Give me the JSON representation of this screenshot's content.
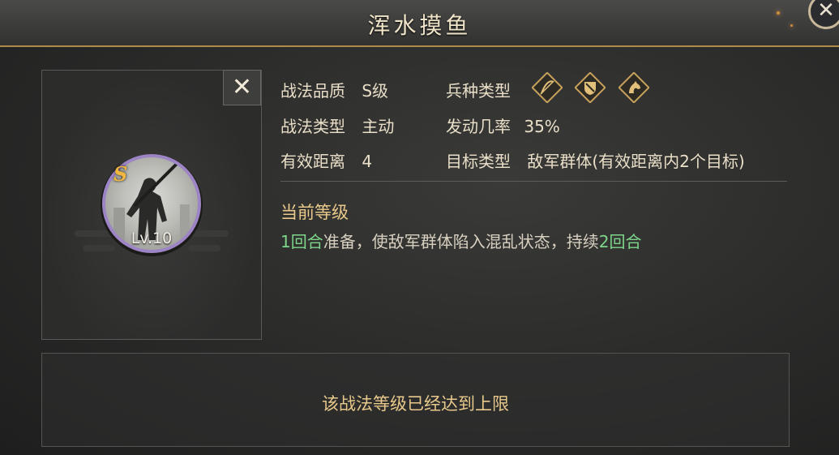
{
  "header": {
    "title": "浑水摸鱼"
  },
  "skill": {
    "rank_badge": "S",
    "level": "Lv.10",
    "quality_label": "战法品质",
    "quality_value": "S级",
    "type_label": "战法类型",
    "type_value": "主动",
    "range_label": "有效距离",
    "range_value": "4",
    "troop_label": "兵种类型",
    "troop_icons": [
      "archer-icon",
      "shield-icon",
      "cavalry-icon"
    ],
    "chance_label": "发动几率",
    "chance_value": "35%",
    "target_label": "目标类型",
    "target_value": "敌军群体(有效距离内2个目标)"
  },
  "current_level": {
    "title": "当前等级",
    "desc_seg1": "1回合",
    "desc_seg2": "准备，使敌军群体陷入混乱状态，持续",
    "desc_seg3": "2回合"
  },
  "footer": {
    "message": "该战法等级已经达到上限"
  },
  "colors": {
    "gold": "#e8c98b",
    "highlight_green": "#7ed68a",
    "purple_ring": "#9d84c4",
    "rank_orange": "#f0b640"
  }
}
